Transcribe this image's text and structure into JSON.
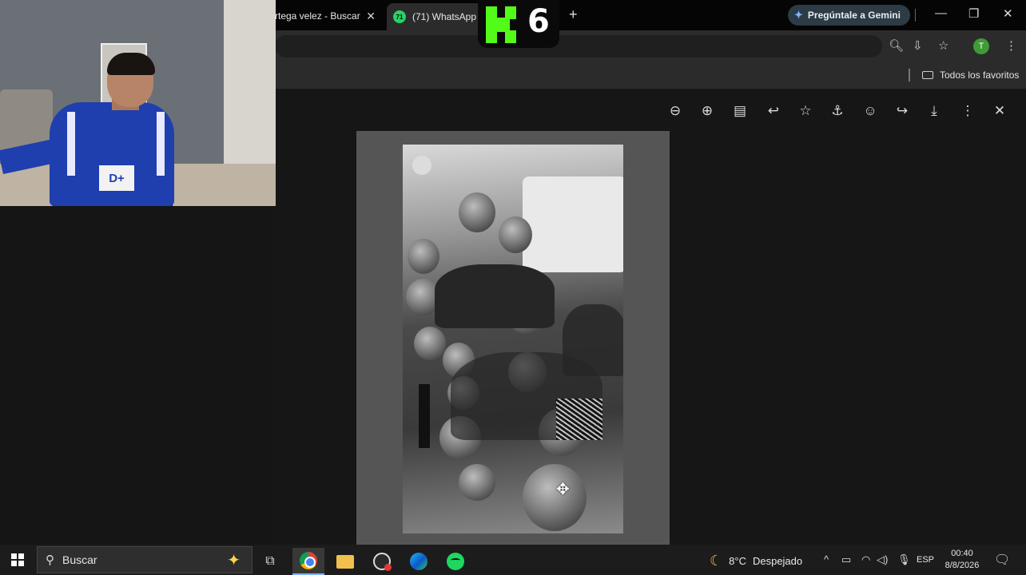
{
  "browser": {
    "tabs": [
      {
        "label": "rtega velez - Buscar",
        "close": "✕"
      },
      {
        "label": "(71) WhatsApp",
        "badge": "71",
        "close": "✕"
      }
    ],
    "new_tab": "+",
    "gemini_label": "Pregúntale a Gemini",
    "window_controls": {
      "minimize": "—",
      "restore": "❐",
      "close": "✕"
    },
    "profile_initial": "T",
    "bookmarks": {
      "folder_label": "Todos los favoritos"
    }
  },
  "stream_overlay": {
    "number": "6",
    "brand_color": "#53fc18"
  },
  "webcam": {
    "jersey_badge": "D+"
  },
  "viewer": {
    "tools": [
      "zoom-out-icon",
      "zoom-in-icon",
      "caption-icon",
      "reply-icon",
      "star-icon",
      "pin-icon",
      "emoji-icon",
      "forward-icon",
      "download-icon",
      "more-icon",
      "close-icon"
    ]
  },
  "taskbar": {
    "search_placeholder": "Buscar",
    "weather": {
      "temp": "8°C",
      "condition": "Despejado"
    },
    "language": "ESP",
    "time": "00:40",
    "date": "8/8/2026"
  }
}
